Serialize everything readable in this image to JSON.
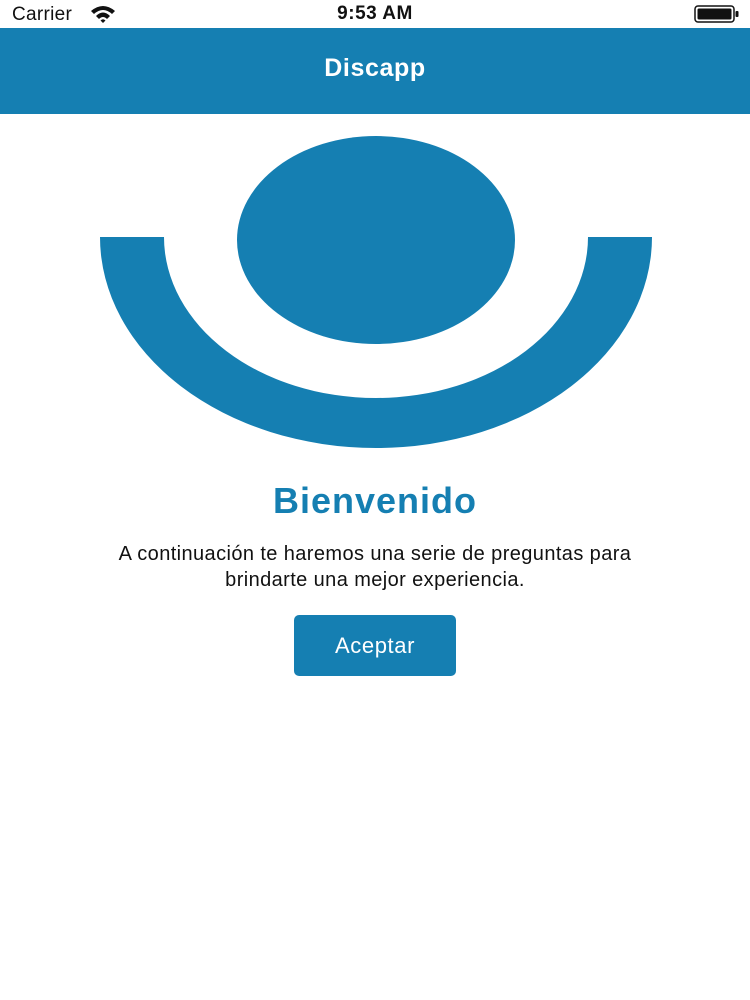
{
  "status_bar": {
    "carrier": "Carrier",
    "time": "9:53 AM"
  },
  "nav": {
    "title": "Discapp"
  },
  "welcome": {
    "title": "Bienvenido",
    "text_line1": "A continuación te haremos una serie de preguntas para",
    "text_line2": "brindarte una mejor experiencia."
  },
  "actions": {
    "accept_label": "Aceptar"
  },
  "icons": {
    "wifi": "wifi-icon",
    "battery": "battery-icon",
    "logo": "smile-logo-icon"
  },
  "colors": {
    "brand": "#157fb2",
    "background": "#ffffff",
    "text": "#111111"
  }
}
